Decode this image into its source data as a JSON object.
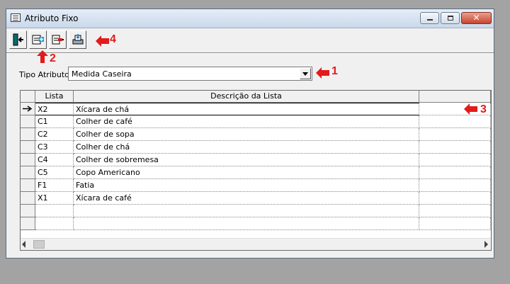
{
  "window": {
    "title": "Atributo Fixo"
  },
  "toolbar": [
    {
      "name": "exit-button",
      "icon": "exit-door-icon"
    },
    {
      "name": "add-button",
      "icon": "add-plus-icon"
    },
    {
      "name": "remove-button",
      "icon": "remove-minus-icon"
    },
    {
      "name": "print-button",
      "icon": "printer-icon"
    }
  ],
  "annotations": {
    "n1": "1",
    "n2": "2",
    "n3": "3",
    "n4": "4"
  },
  "form": {
    "label": "Tipo Atributo",
    "selected": "Medida Caseira"
  },
  "grid": {
    "headers": {
      "code": "Lista",
      "desc": "Descrição da Lista",
      "extra": ""
    },
    "rows": [
      {
        "code": "X2",
        "desc": "Xícara de chá"
      },
      {
        "code": "C1",
        "desc": "Colher de café"
      },
      {
        "code": "C2",
        "desc": "Colher de sopa"
      },
      {
        "code": "C3",
        "desc": "Colher de chá"
      },
      {
        "code": "C4",
        "desc": "Colher de sobremesa"
      },
      {
        "code": "C5",
        "desc": "Copo Americano"
      },
      {
        "code": "F1",
        "desc": "Fatia"
      },
      {
        "code": "X1",
        "desc": "Xícara de café"
      }
    ]
  },
  "colors": {
    "annotation": "#e21b1b",
    "background": "#a3a3a3"
  }
}
